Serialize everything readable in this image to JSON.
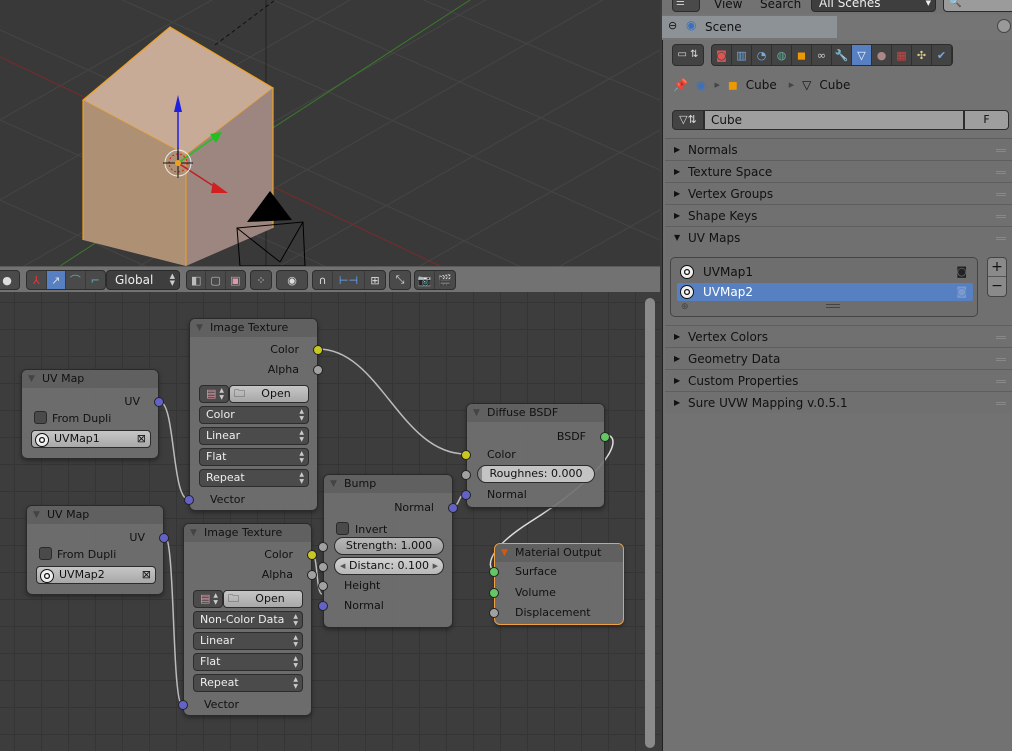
{
  "outliner": {
    "menu_view": "View",
    "menu_search": "Search",
    "scene_filter": "All Scenes",
    "scene_item": "Scene"
  },
  "viewport_toolbar": {
    "orientation": "Global"
  },
  "properties": {
    "breadcrumb": [
      "Cube",
      "Cube"
    ],
    "mesh_name": "Cube",
    "fake_user": "F",
    "tab_icons": [
      "render-icon",
      "render-layers-icon",
      "scene-icon",
      "world-icon",
      "object-icon",
      "constraints-icon",
      "modifiers-icon",
      "mesh-data-icon",
      "material-icon",
      "texture-icon",
      "particles-icon",
      "physics-icon"
    ],
    "active_tab": "mesh-data-icon",
    "panels_top": [
      "Normals",
      "Texture Space",
      "Vertex Groups",
      "Shape Keys"
    ],
    "uv_maps_panel": "UV Maps",
    "uv_maps": [
      {
        "name": "UVMap1",
        "active": false
      },
      {
        "name": "UVMap2",
        "active": true
      }
    ],
    "panels_bottom": [
      "Vertex Colors",
      "Geometry Data",
      "Custom Properties",
      "Sure UVW Mapping v.0.5.1"
    ],
    "add_label": "+",
    "remove_label": "−"
  },
  "nodes": {
    "uvmap1": {
      "title": "UV Map",
      "output": "UV",
      "from_dupli": "From Dupli",
      "map": "UVMap1"
    },
    "uvmap2": {
      "title": "UV Map",
      "output": "UV",
      "from_dupli": "From Dupli",
      "map": "UVMap2"
    },
    "imgtex1": {
      "title": "Image Texture",
      "out_color": "Color",
      "out_alpha": "Alpha",
      "open": "Open",
      "color_space": "Color",
      "interpolation": "Linear",
      "projection": "Flat",
      "extension": "Repeat",
      "in_vector": "Vector"
    },
    "imgtex2": {
      "title": "Image Texture",
      "out_color": "Color",
      "out_alpha": "Alpha",
      "open": "Open",
      "color_space": "Non-Color Data",
      "interpolation": "Linear",
      "projection": "Flat",
      "extension": "Repeat",
      "in_vector": "Vector"
    },
    "bump": {
      "title": "Bump",
      "out_normal": "Normal",
      "invert": "Invert",
      "strength": "Strength: 1.000",
      "distance": "Distanc:  0.100",
      "in_height": "Height",
      "in_normal": "Normal"
    },
    "diffuse": {
      "title": "Diffuse BSDF",
      "out_bsdf": "BSDF",
      "in_color": "Color",
      "roughness": "Roughnes:  0.000",
      "in_normal": "Normal"
    },
    "output": {
      "title": "Material Output",
      "in_surface": "Surface",
      "in_volume": "Volume",
      "in_displacement": "Displacement"
    }
  },
  "colors": {
    "accent": "#5680c2",
    "selection": "#f0a040",
    "socket_color": "#c8c820",
    "socket_vector": "#6363c7",
    "socket_shader": "#63c763",
    "socket_float": "#a1a1a1"
  }
}
